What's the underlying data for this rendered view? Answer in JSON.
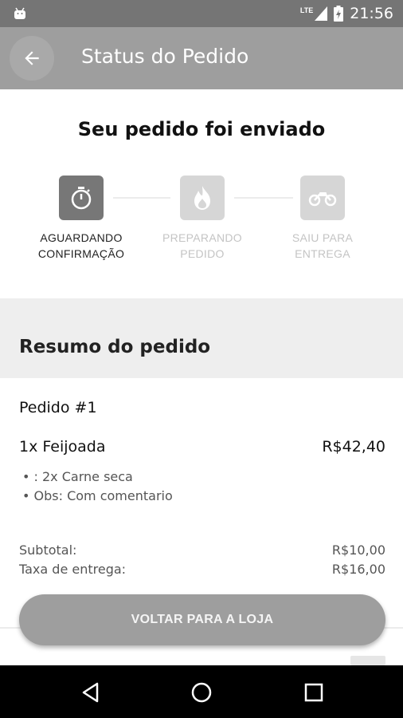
{
  "status_bar": {
    "network": "LTE",
    "time": "21:56"
  },
  "app_bar": {
    "title": "Status do Pedido",
    "back_icon": "arrow-back-icon"
  },
  "status": {
    "headline": "Seu pedido foi enviado",
    "steps": [
      {
        "label_line1": "AGUARDANDO",
        "label_line2": "CONFIRMAÇÃO",
        "icon": "stopwatch-icon",
        "active": true
      },
      {
        "label_line1": "PREPARANDO",
        "label_line2": "PEDIDO",
        "icon": "flame-icon",
        "active": false
      },
      {
        "label_line1": "SAIU PARA",
        "label_line2": "ENTREGA",
        "icon": "motorcycle-icon",
        "active": false
      }
    ]
  },
  "summary": {
    "title": "Resumo do pedido",
    "order_number": "Pedido #1",
    "items": [
      {
        "name": "1x Feijoada",
        "price": "R$42,40",
        "details": [
          "• : 2x Carne seca",
          "• Obs: Com comentario"
        ]
      }
    ],
    "subtotal_label": "Subtotal:",
    "subtotal_value": "R$10,00",
    "delivery_label": "Taxa de entrega:",
    "delivery_value": "R$16,00"
  },
  "actions": {
    "back_to_store": "VOLTAR PARA A LOJA"
  },
  "colors": {
    "app_bar": "#9e9e9e",
    "status_bar": "#757575",
    "active_step": "#777777",
    "inactive_step": "#d6d6d6"
  }
}
